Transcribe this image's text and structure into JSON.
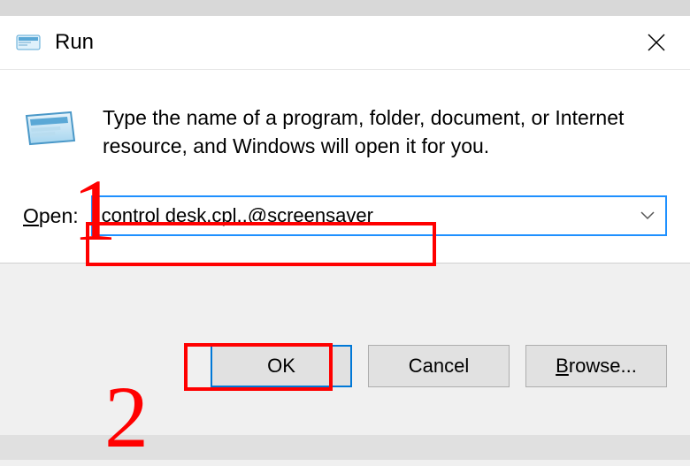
{
  "window": {
    "title": "Run",
    "description": "Type the name of a program, folder, document, or Internet resource, and Windows will open it for you."
  },
  "form": {
    "open_label_prefix": "O",
    "open_label_rest": "pen:",
    "command_value": "control desk.cpl,,@screensaver"
  },
  "buttons": {
    "ok": "OK",
    "cancel": "Cancel",
    "browse_prefix": "B",
    "browse_rest": "rowse..."
  },
  "annotations": {
    "num1": "1",
    "num2": "2"
  }
}
